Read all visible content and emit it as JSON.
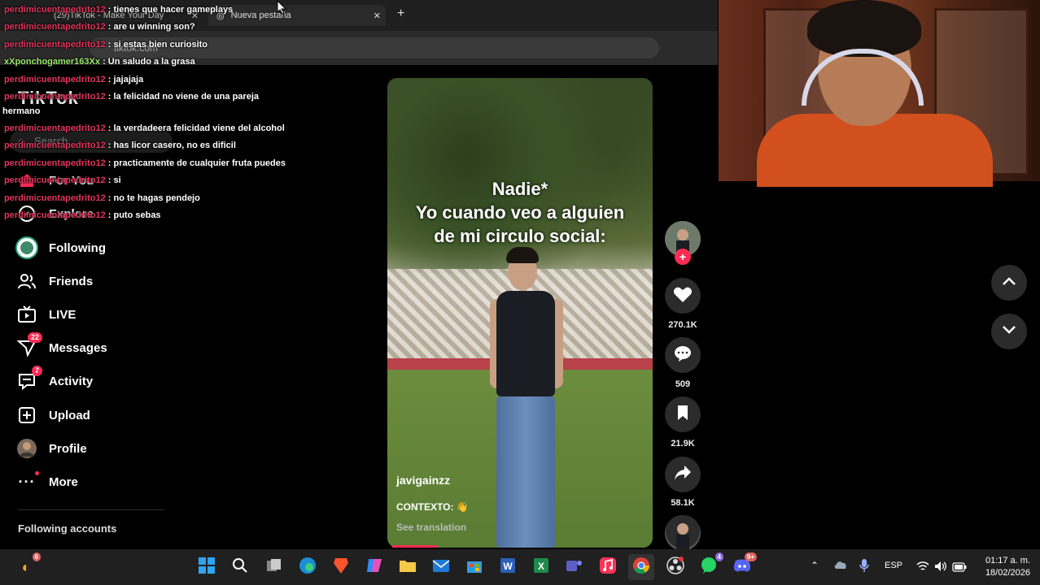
{
  "browser": {
    "tabs": [
      {
        "label": "(29)TikTok - Make Your Day"
      },
      {
        "label": "Nueva pestaña"
      }
    ],
    "url": "tiktok.com"
  },
  "sidebar": {
    "logo": "TikTok",
    "search_placeholder": "Search",
    "items": [
      {
        "label": "For You",
        "icon": "home-icon"
      },
      {
        "label": "Explore",
        "icon": "compass-icon"
      },
      {
        "label": "Following",
        "icon": "following-avatar-icon"
      },
      {
        "label": "Friends",
        "icon": "friends-icon"
      },
      {
        "label": "LIVE",
        "icon": "live-tv-icon"
      },
      {
        "label": "Messages",
        "icon": "send-icon",
        "badge": "22"
      },
      {
        "label": "Activity",
        "icon": "inbox-icon",
        "badge": "7"
      },
      {
        "label": "Upload",
        "icon": "plus-square-icon"
      },
      {
        "label": "Profile",
        "icon": "profile-avatar-icon"
      },
      {
        "label": "More",
        "icon": "more-icon"
      }
    ],
    "following_accounts": "Following accounts"
  },
  "chat": {
    "messages": [
      {
        "user": "perdimicuentapedrito12",
        "text": ": tienes que hacer gameplays"
      },
      {
        "user": "perdimicuentapedrito12",
        "text": ": are u winning son?"
      },
      {
        "user": "perdimicuentapedrito12",
        "text": ": si estas bien curiosito"
      },
      {
        "user": "xXponchogamer163Xx",
        "text": ": Un saludo a la grasa"
      },
      {
        "user": "perdimicuentapedrito12",
        "text": ": jajajaja"
      },
      {
        "user": "perdimicuentapedrito12",
        "text": ": la felicidad no viene de una pareja"
      },
      {
        "user": "",
        "text": "hermano"
      },
      {
        "user": "perdimicuentapedrito12",
        "text": ": la verdadeera felicidad viene del alcohol"
      },
      {
        "user": "perdimicuentapedrito12",
        "text": ": has licor casero, no es dificil"
      },
      {
        "user": "perdimicuentapedrito12",
        "text": ": practicamente de cualquier fruta puedes"
      },
      {
        "user": "perdimicuentapedrito12",
        "text": ": si"
      },
      {
        "user": "perdimicuentapedrito12",
        "text": ": no te hagas pendejo"
      },
      {
        "user": "perdimicuentapedrito12",
        "text": ": puto sebas"
      }
    ]
  },
  "video": {
    "caption_line1": "Nadie*",
    "caption_line2": "Yo cuando veo a alguien",
    "caption_line3": "de mi circulo social:",
    "author": "javigainzz",
    "description": "CONTEXTO: 👋",
    "see_translation": "See translation"
  },
  "actions": {
    "likes": "270.1K",
    "comments": "509",
    "saves": "21.9K",
    "shares": "58.1K"
  },
  "taskbar": {
    "language": "ESP",
    "time": "01:17 a. m.",
    "date": "18/02/2026",
    "badges": {
      "left": "6",
      "teams": "4",
      "discord": "9+"
    }
  },
  "colors": {
    "accent": "#fe2c55",
    "chat_user": "#e0355a",
    "chat_user_alt": "#9be86a"
  }
}
